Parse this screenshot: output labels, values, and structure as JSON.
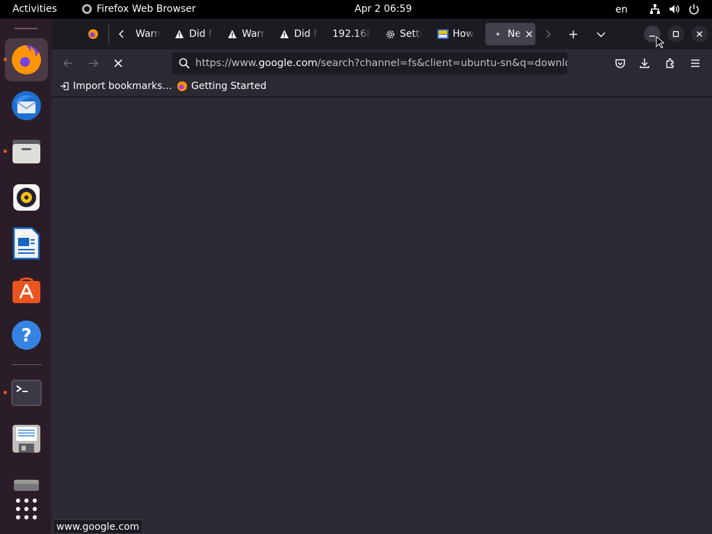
{
  "topbar": {
    "activities": "Activities",
    "app_name": "Firefox Web Browser",
    "clock": "Apr 2  06:59",
    "lang": "en"
  },
  "dock": {
    "items": [
      {
        "name": "firefox",
        "running": true,
        "active": true
      },
      {
        "name": "thunderbird",
        "running": false
      },
      {
        "name": "files",
        "running": true
      },
      {
        "name": "rhythmbox",
        "running": false
      },
      {
        "name": "libreoffice-writer",
        "running": false
      },
      {
        "name": "app-center",
        "running": false
      },
      {
        "name": "help",
        "running": false
      },
      {
        "name": "terminal",
        "running": true
      },
      {
        "name": "save-floppy",
        "running": false
      },
      {
        "name": "drive",
        "running": false
      },
      {
        "name": "show-apps",
        "running": false
      }
    ]
  },
  "tabs": [
    {
      "title": "Warn",
      "icon": "warning-icon"
    },
    {
      "title": "Did N",
      "icon": "warning-icon"
    },
    {
      "title": "Warn",
      "icon": "warning-icon"
    },
    {
      "title": "Did N",
      "icon": "warning-icon"
    },
    {
      "title": "192.168",
      "icon": "none"
    },
    {
      "title": "Setti",
      "icon": "gear-icon"
    },
    {
      "title": "How",
      "icon": "site-favicon"
    },
    {
      "title": "Ne",
      "icon": "loading-dot",
      "selected": true
    }
  ],
  "urlbar": {
    "prefix": "https://www.",
    "host": "google.com",
    "path": "/search?channel=fs&client=ubuntu-sn&q=download"
  },
  "bookmarks": [
    {
      "label": "Import bookmarks…",
      "icon": "import-icon"
    },
    {
      "label": "Getting Started",
      "icon": "firefox-icon"
    }
  ],
  "status": {
    "text": "www.google.com"
  },
  "colors": {
    "accent": "#e95420",
    "toolbar": "#2b2a33",
    "tabstrip": "#1c1b22"
  }
}
